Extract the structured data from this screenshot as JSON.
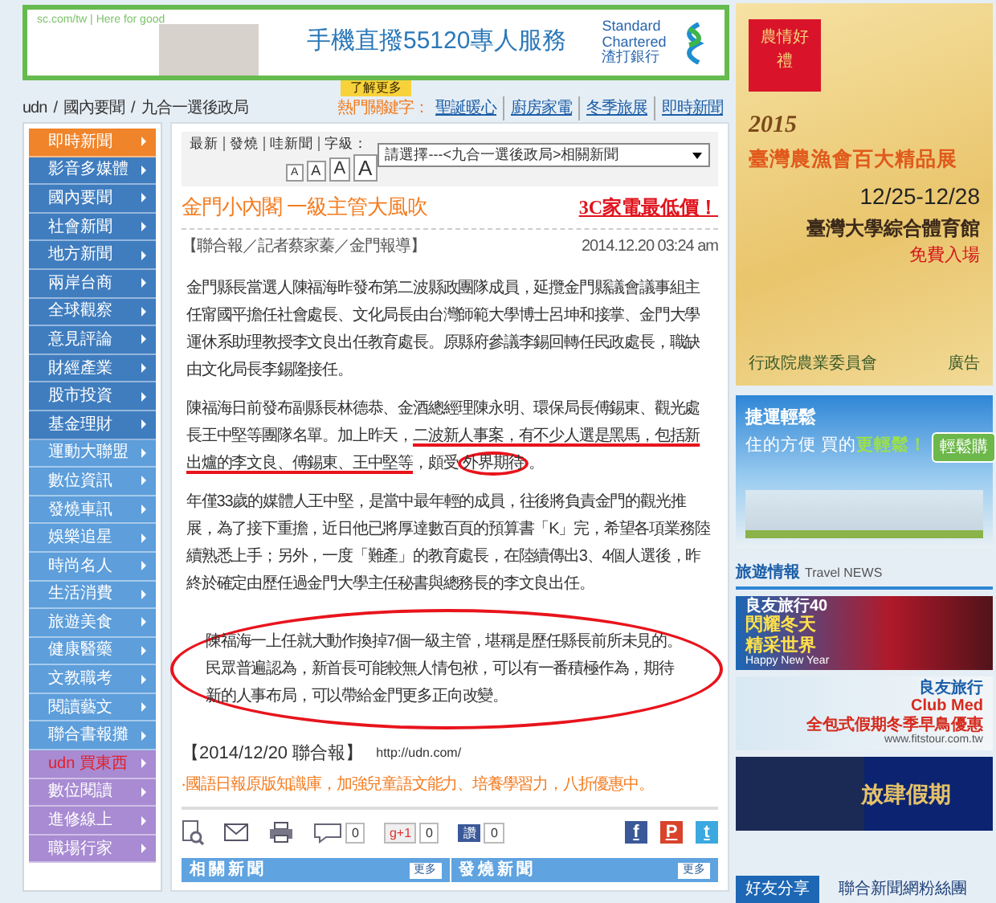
{
  "banner": {
    "tagline": "sc.com/tw | Here for good",
    "headline": "手機直撥55120專人服務",
    "brand": "Standard Chartered",
    "brand_local": "渣打銀行",
    "more": "了解更多"
  },
  "breadcrumb": {
    "separator": "/",
    "items": [
      "udn",
      "國內要聞",
      "九合一選後政局"
    ]
  },
  "hot_keywords": {
    "label": "熱門關鍵字：",
    "items": [
      "聖誕暖心",
      "廚房家電",
      "冬季旅展",
      "即時新聞"
    ]
  },
  "sidebar": {
    "items": [
      {
        "label": "即時新聞",
        "color": "#f0842a",
        "emphasis": false
      },
      {
        "label": "影音多媒體",
        "color": "#3f7dbf",
        "emphasis": false
      },
      {
        "label": "國內要聞",
        "color": "#3f7dbf",
        "emphasis": false
      },
      {
        "label": "社會新聞",
        "color": "#3f7dbf",
        "emphasis": false
      },
      {
        "label": "地方新聞",
        "color": "#3f7dbf",
        "emphasis": false
      },
      {
        "label": "兩岸台商",
        "color": "#3f7dbf",
        "emphasis": false
      },
      {
        "label": "全球觀察",
        "color": "#3f7dbf",
        "emphasis": false
      },
      {
        "label": "意見評論",
        "color": "#3f7dbf",
        "emphasis": false
      },
      {
        "label": "財經產業",
        "color": "#3f7dbf",
        "emphasis": false
      },
      {
        "label": "股市投資",
        "color": "#3f7dbf",
        "emphasis": false
      },
      {
        "label": "基金理財",
        "color": "#3f7dbf",
        "emphasis": false
      },
      {
        "label": "運動大聯盟",
        "color": "#5d9edb",
        "emphasis": false
      },
      {
        "label": "數位資訊",
        "color": "#5d9edb",
        "emphasis": false
      },
      {
        "label": "發燒車訊",
        "color": "#5d9edb",
        "emphasis": false
      },
      {
        "label": "娛樂追星",
        "color": "#5d9edb",
        "emphasis": false
      },
      {
        "label": "時尚名人",
        "color": "#5d9edb",
        "emphasis": false
      },
      {
        "label": "生活消費",
        "color": "#5d9edb",
        "emphasis": false
      },
      {
        "label": "旅遊美食",
        "color": "#5d9edb",
        "emphasis": false
      },
      {
        "label": "健康醫藥",
        "color": "#5d9edb",
        "emphasis": false
      },
      {
        "label": "文教職考",
        "color": "#5d9edb",
        "emphasis": false
      },
      {
        "label": "閱讀藝文",
        "color": "#5d9edb",
        "emphasis": false
      },
      {
        "label": "聯合書報攤",
        "color": "#5d9edb",
        "emphasis": false
      },
      {
        "label": "udn 買東西",
        "color": "#a88bd2",
        "emphasis": true
      },
      {
        "label": "數位閱讀",
        "color": "#a88bd2",
        "emphasis": false
      },
      {
        "label": "進修線上",
        "color": "#a88bd2",
        "emphasis": false
      },
      {
        "label": "職場行家",
        "color": "#a88bd2",
        "emphasis": false
      }
    ]
  },
  "article": {
    "tools": [
      "最新",
      "發燒",
      "哇新聞"
    ],
    "font_size_label": "字級：",
    "font_size_buttons": [
      "A",
      "A",
      "A",
      "A"
    ],
    "related_select": "請選擇---<九合一選後政局>相關新聞",
    "title": "金門小內閣 一級主管大風吹",
    "promo_link": "3C家電最低價！",
    "byline": "【聯合報／記者蔡家蓁／金門報導】",
    "date": "2014.12.20 03:24 am",
    "paragraphs": [
      {
        "segments": [
          {
            "text": "金門縣長當選人陳福海昨發布第二波縣政團隊成員，延攬金門縣議會議事組主任甯國平擔任社會處長、文化局長由台灣師範大學博士呂坤和接掌、金門大學運休系助理教授李文良出任教育處長。原縣府參議李錫回轉任民政處長，職缺由文化局長李錫隆接任。"
          }
        ]
      },
      {
        "segments": [
          {
            "text": "陳福海日前發布副縣長林德恭、金酒總經理陳永明、環保局長傅錫東、觀光處長王中堅等團隊名單。加上昨天，"
          },
          {
            "text": "二波新人事案，有不少人選是黑馬，包括新出爐的李文良、傅錫東、王中堅等",
            "underlined": true
          },
          {
            "text": "，頗受"
          },
          {
            "text": "外界期待",
            "circled": true
          },
          {
            "text": "。"
          }
        ]
      },
      {
        "segments": [
          {
            "text": "年僅33歲的媒體人王中堅，是當中最年輕的成員，往後將負責金門的觀光推展，為了接下重擔，近日他已將厚達數百頁的預算書「K」完，希望各項業務陸續熟悉上手；另外，一度「難產」的教育處長，在陸續傳出3、4個人選後，昨終於確定由歷任過金門大學主任秘書與總務長的李文良出任。"
          }
        ]
      },
      {
        "encircled": true,
        "segments": [
          {
            "text": "陳福海一上任就大動作換掉7個一級主管，堪稱是歷任縣長前所未見的。民眾普遍認為，新首長可能較無人情包袱，可以有一番積極作為，期待新的人事布局，可以帶給金門更多正向改變。"
          }
        ]
      }
    ],
    "source": "【2014/12/20 聯合報】",
    "source_url": "http://udn.com/",
    "ad_link": "‧國語日報原版知識庫，加強兒童語文能力、培養學習力，八折優惠中。",
    "share": {
      "comments": "0",
      "gplus_label": "g+1",
      "gplus": "0",
      "fb_like_label": "讚",
      "fb_like": "0",
      "networks": [
        {
          "glyph": "f",
          "color": "#3b5998"
        },
        {
          "glyph": "P",
          "color": "#d9432b"
        },
        {
          "glyph": "t",
          "color": "#3ba9e0"
        }
      ]
    }
  },
  "news_tabs": [
    {
      "title": "相關新聞",
      "more": "更多"
    },
    {
      "title": "發燒新聞",
      "more": "更多"
    }
  ],
  "right": {
    "expo_ad": {
      "badge": "農情好禮",
      "year": "2015",
      "title": "臺灣農漁會百大精品展",
      "dates": "12/25-12/28",
      "venue": "臺灣大學綜合體育館",
      "note": "免費入場",
      "sponsor": "行政院農業委員會",
      "ad_label": "廣告"
    },
    "metro_ad": {
      "title": "捷運輕鬆",
      "slogan": "住的方便 買的",
      "highlight": "更輕鬆！",
      "button": "輕鬆購"
    },
    "travel": {
      "title": "旅遊情報",
      "subtitle": "Travel NEWS"
    },
    "travel_ads": [
      {
        "kind": "winter",
        "brand": "良友旅行40",
        "lines": [
          "閃耀冬天",
          "精采世界"
        ],
        "extra": "Happy New Year"
      },
      {
        "kind": "clubmed",
        "brand": "良友旅行",
        "lines": [
          "Club Med",
          "全包式假期冬季早鳥優惠"
        ],
        "extra": "www.fitstour.com.tw"
      },
      {
        "kind": "night",
        "lines": [
          "放肆假期"
        ]
      }
    ],
    "social_tabs": [
      {
        "label": "好友分享",
        "selected": true
      },
      {
        "label": "聯合新聞網粉絲團",
        "selected": false
      }
    ]
  }
}
